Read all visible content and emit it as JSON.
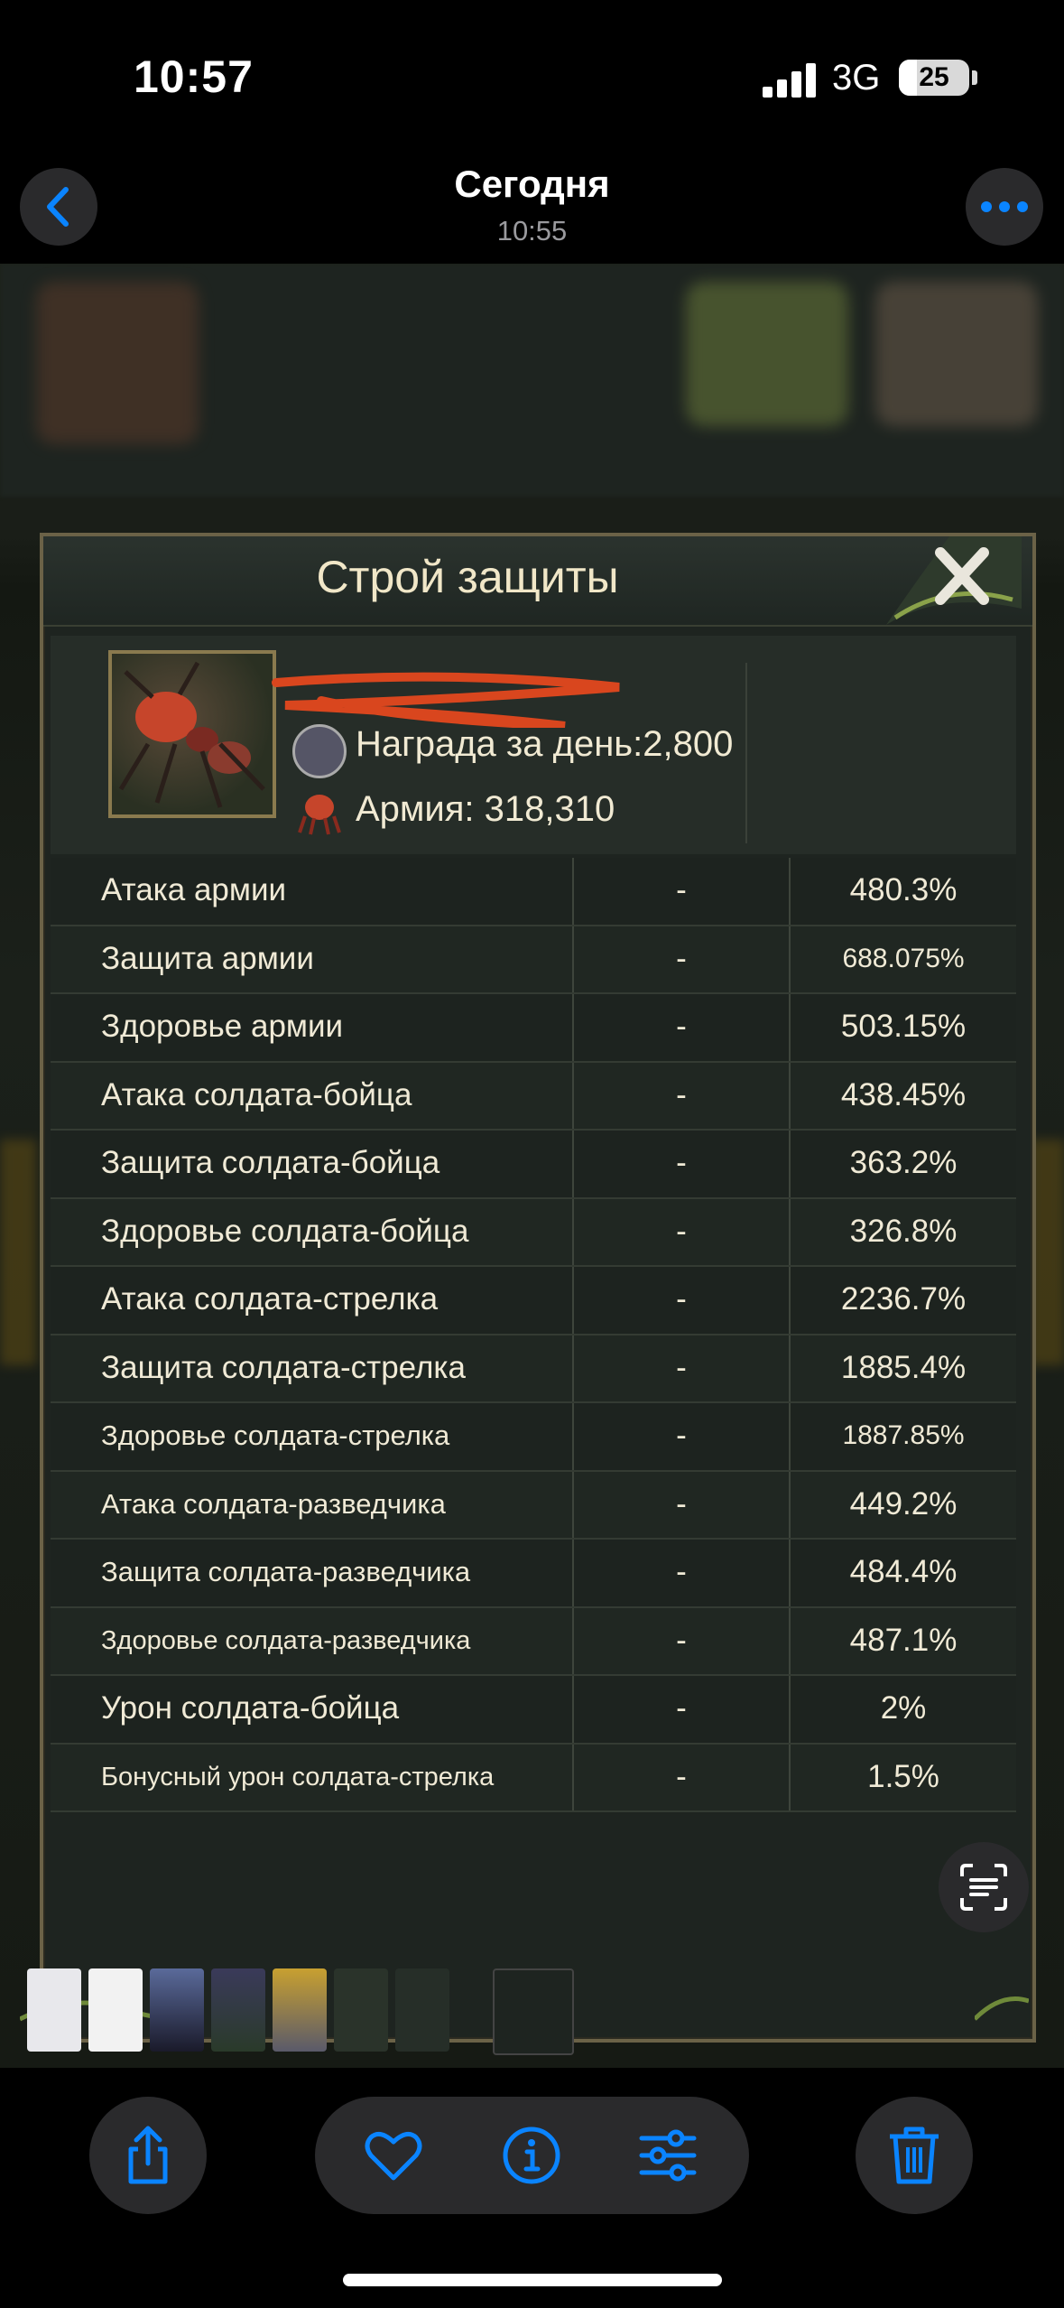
{
  "status_bar": {
    "time": "10:57",
    "network": "3G",
    "battery": "25",
    "battery_level": 0.25
  },
  "header": {
    "title": "Сегодня",
    "subtitle": "10:55"
  },
  "game_dialog": {
    "title": "Строй защиты",
    "reward_label": "Награда за день:2,800",
    "army_label": "Армия: 318,310",
    "stats": [
      {
        "name": "Атака армии",
        "mid": "-",
        "value": "480.3%"
      },
      {
        "name": "Защита армии",
        "mid": "-",
        "value": "688.075%"
      },
      {
        "name": "Здоровье армии",
        "mid": "-",
        "value": "503.15%"
      },
      {
        "name": "Атака солдата-бойца",
        "mid": "-",
        "value": "438.45%"
      },
      {
        "name": "Защита солдата-бойца",
        "mid": "-",
        "value": "363.2%"
      },
      {
        "name": "Здоровье солдата-бойца",
        "mid": "-",
        "value": "326.8%"
      },
      {
        "name": "Атака солдата-стрелка",
        "mid": "-",
        "value": "2236.7%"
      },
      {
        "name": "Защита солдата-стрелка",
        "mid": "-",
        "value": "1885.4%"
      },
      {
        "name": "Здоровье солдата-стрелка",
        "mid": "-",
        "value": "1887.85%"
      },
      {
        "name": "Атака солдата-разведчика",
        "mid": "-",
        "value": "449.2%"
      },
      {
        "name": "Защита солдата-разведчика",
        "mid": "-",
        "value": "484.4%"
      },
      {
        "name": "Здоровье солдата-разведчика",
        "mid": "-",
        "value": "487.1%"
      },
      {
        "name": "Урон солдата-бойца",
        "mid": "-",
        "value": "2%"
      },
      {
        "name": "Бонусный урон солдата-стрелка",
        "mid": "-",
        "value": "1.5%"
      }
    ]
  },
  "colors": {
    "accent": "#0a84ff",
    "panel_text": "#f0ead6",
    "button_bg": "#2a2a2c"
  },
  "icons": {
    "back": "chevron-left-icon",
    "more": "ellipsis-icon",
    "live_text": "live-text-icon",
    "share": "share-icon",
    "favorite": "heart-icon",
    "info": "info-icon",
    "adjust": "sliders-icon",
    "delete": "trash-icon",
    "close": "close-icon"
  }
}
